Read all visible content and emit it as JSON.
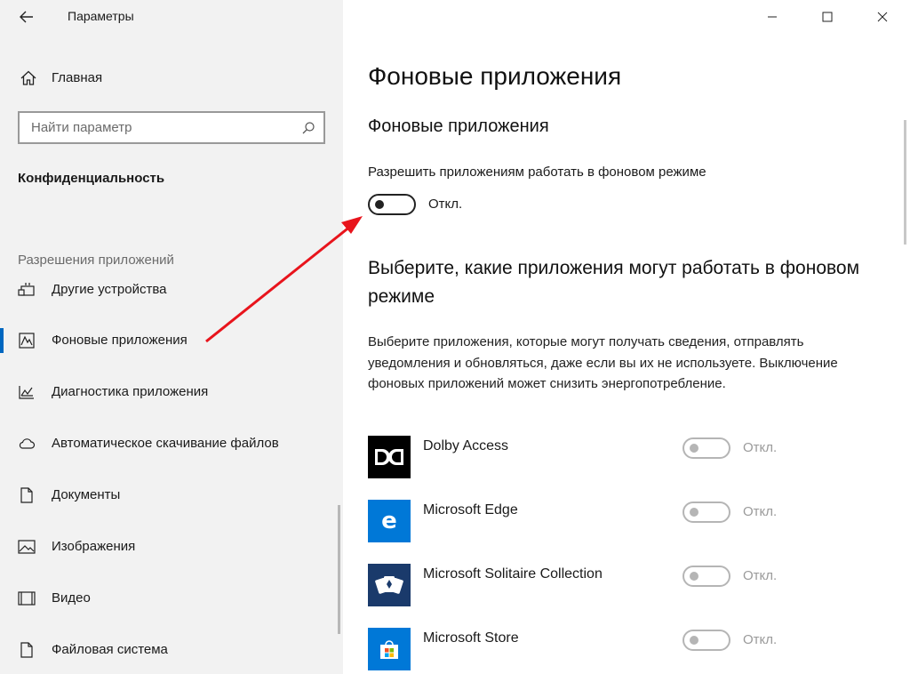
{
  "window": {
    "app_title": "Параметры",
    "controls": {
      "minimize": "minimize-icon",
      "maximize": "maximize-icon",
      "close": "close-icon"
    }
  },
  "sidebar": {
    "home_label": "Главная",
    "search_placeholder": "Найти параметр",
    "section_title": "Конфиденциальность",
    "group_title": "Разрешения приложений",
    "items": [
      {
        "label": "Другие устройства",
        "icon": "devices-icon"
      },
      {
        "label": "Фоновые приложения",
        "icon": "background-apps-icon",
        "active": true
      },
      {
        "label": "Диагностика приложения",
        "icon": "diagnostics-icon"
      },
      {
        "label": "Автоматическое скачивание файлов",
        "icon": "cloud-icon"
      },
      {
        "label": "Документы",
        "icon": "document-icon"
      },
      {
        "label": "Изображения",
        "icon": "image-icon"
      },
      {
        "label": "Видео",
        "icon": "video-icon"
      },
      {
        "label": "Файловая система",
        "icon": "file-icon"
      }
    ]
  },
  "main": {
    "page_title": "Фоновые приложения",
    "sub_title": "Фоновые приложения",
    "allow_label": "Разрешить приложениям работать в фоновом режиме",
    "allow_toggle_state": "Откл.",
    "choose_heading": "Выберите, какие приложения могут работать в фоновом режиме",
    "description": "Выберите приложения, которые могут получать сведения, отправлять уведомления и обновляться, даже если вы их не используете. Выключение фоновых приложений может снизить энергопотребление.",
    "apps": [
      {
        "name": "Dolby Access",
        "state": "Откл.",
        "tile_color": "#000000",
        "icon": "dolby-icon"
      },
      {
        "name": "Microsoft Edge",
        "state": "Откл.",
        "tile_color": "#0078d7",
        "icon": "edge-icon"
      },
      {
        "name": "Microsoft Solitaire Collection",
        "state": "Откл.",
        "tile_color": "#1a3a6b",
        "icon": "solitaire-icon"
      },
      {
        "name": "Microsoft Store",
        "state": "Откл.",
        "tile_color": "#0078d7",
        "icon": "store-icon"
      }
    ]
  },
  "colors": {
    "accent": "#0067c0",
    "annotation_arrow": "#e8141c",
    "sidebar_bg": "#f2f2f2"
  }
}
